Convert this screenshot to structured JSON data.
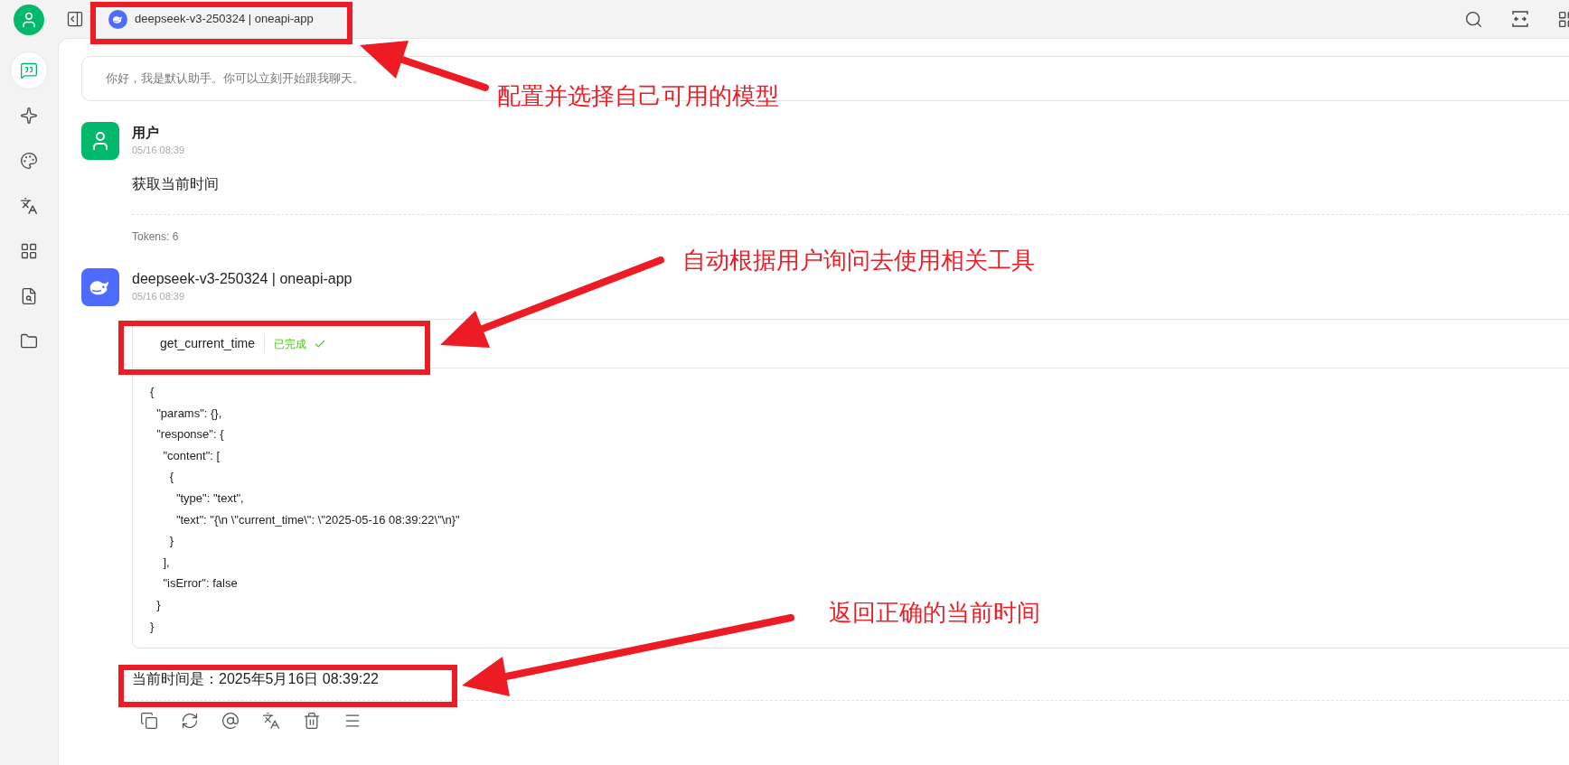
{
  "top_bar": {
    "model_title": "deepseek-v3-250324 | oneapi-app"
  },
  "sidebar": {
    "items": [
      {
        "kind": "chat",
        "selected": true
      },
      {
        "kind": "sparkle",
        "selected": false
      },
      {
        "kind": "palette",
        "selected": false
      },
      {
        "kind": "translate",
        "selected": false
      },
      {
        "kind": "apps",
        "selected": false
      },
      {
        "kind": "file-search",
        "selected": false
      },
      {
        "kind": "folder",
        "selected": false
      }
    ]
  },
  "welcome": "你好，我是默认助手。你可以立刻开始跟我聊天。",
  "messages": [
    {
      "kind": "user",
      "name": "用户",
      "time": "05/16 08:39",
      "text": "获取当前时间",
      "tokens": "Tokens: 6"
    },
    {
      "kind": "assistant",
      "name": "deepseek-v3-250324 | oneapi-app",
      "time": "05/16 08:39",
      "tool_call": {
        "name": "get_current_time",
        "status": "已完成",
        "completed": true,
        "code_lines": [
          "{",
          "  \"params\": {},",
          "  \"response\": {",
          "    \"content\": [",
          "      {",
          "        \"type\": \"text\",",
          "        \"text\": \"{\\n \\\"current_time\\\": \\\"2025-05-16 08:39:22\\\"\\n}\"",
          "      }",
          "    ],",
          "    \"isError\": false",
          "  }",
          "}"
        ]
      },
      "text": "当前时间是：2025年5月16日 08:39:22"
    }
  ],
  "annotations": [
    {
      "text": "配置并选择自己可用的模型"
    },
    {
      "text": "自动根据用户询问去使用相关工具"
    },
    {
      "text": "返回正确的当前时间"
    }
  ]
}
